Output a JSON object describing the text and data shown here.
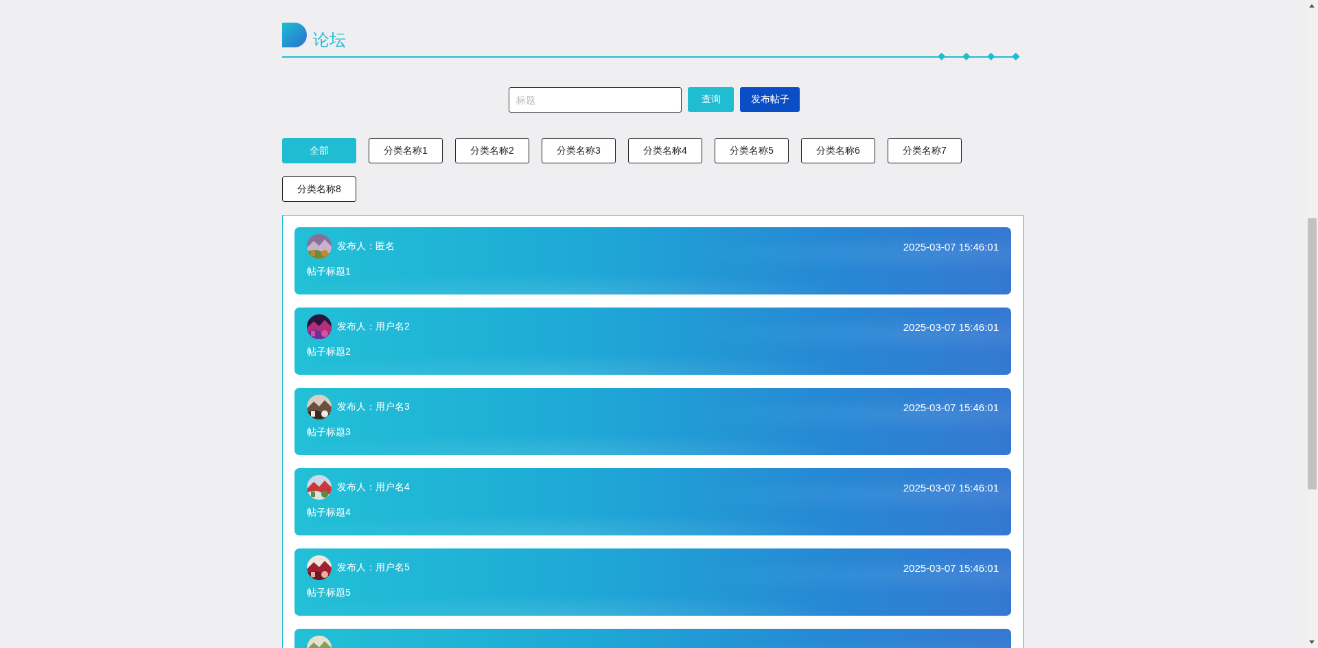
{
  "header": {
    "title": "论坛"
  },
  "search": {
    "placeholder": "标题",
    "buttons": [
      {
        "label": "查询",
        "kind": "query"
      },
      {
        "label": "发布帖子",
        "kind": "publish"
      }
    ]
  },
  "categories": [
    {
      "label": "全部",
      "selected": true
    },
    {
      "label": "分类名称1",
      "selected": false
    },
    {
      "label": "分类名称2",
      "selected": false
    },
    {
      "label": "分类名称3",
      "selected": false
    },
    {
      "label": "分类名称4",
      "selected": false
    },
    {
      "label": "分类名称5",
      "selected": false
    },
    {
      "label": "分类名称6",
      "selected": false
    },
    {
      "label": "分类名称7",
      "selected": false
    },
    {
      "label": "分类名称8",
      "selected": false
    }
  ],
  "posts": [
    {
      "author": "发布人：匿名",
      "time": "2025-03-07 15:46:01",
      "title": "帖子标题1"
    },
    {
      "author": "发布人：用户名2",
      "time": "2025-03-07 15:46:01",
      "title": "帖子标题2"
    },
    {
      "author": "发布人：用户名3",
      "time": "2025-03-07 15:46:01",
      "title": "帖子标题3"
    },
    {
      "author": "发布人：用户名4",
      "time": "2025-03-07 15:46:01",
      "title": "帖子标题4"
    },
    {
      "author": "发布人：用户名5",
      "time": "2025-03-07 15:46:01",
      "title": "帖子标题5"
    }
  ],
  "more_posts_cut_off": true
}
